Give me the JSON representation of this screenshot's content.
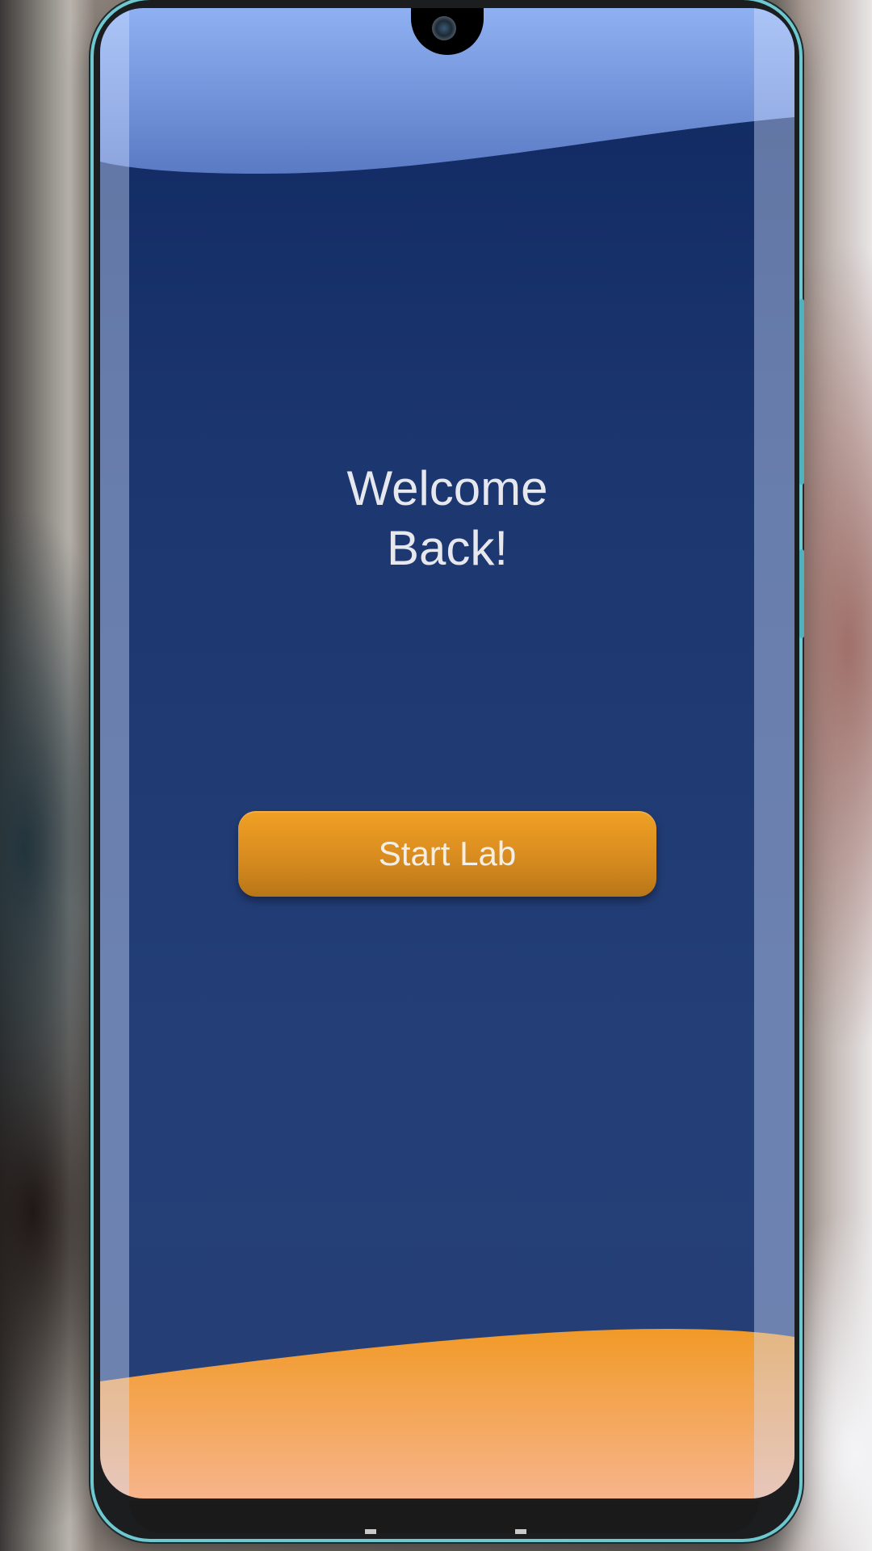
{
  "screen": {
    "welcome_text": "Welcome\nBack!",
    "start_button_label": "Start Lab"
  },
  "colors": {
    "background_navy": "#1c3670",
    "accent_orange": "#e89a23",
    "top_wave_blue": "#7fa3ea",
    "bottom_wave_peach": "#f8b48a",
    "text_light": "#e6e8ee"
  },
  "icons": {
    "camera": "front-camera-icon"
  }
}
